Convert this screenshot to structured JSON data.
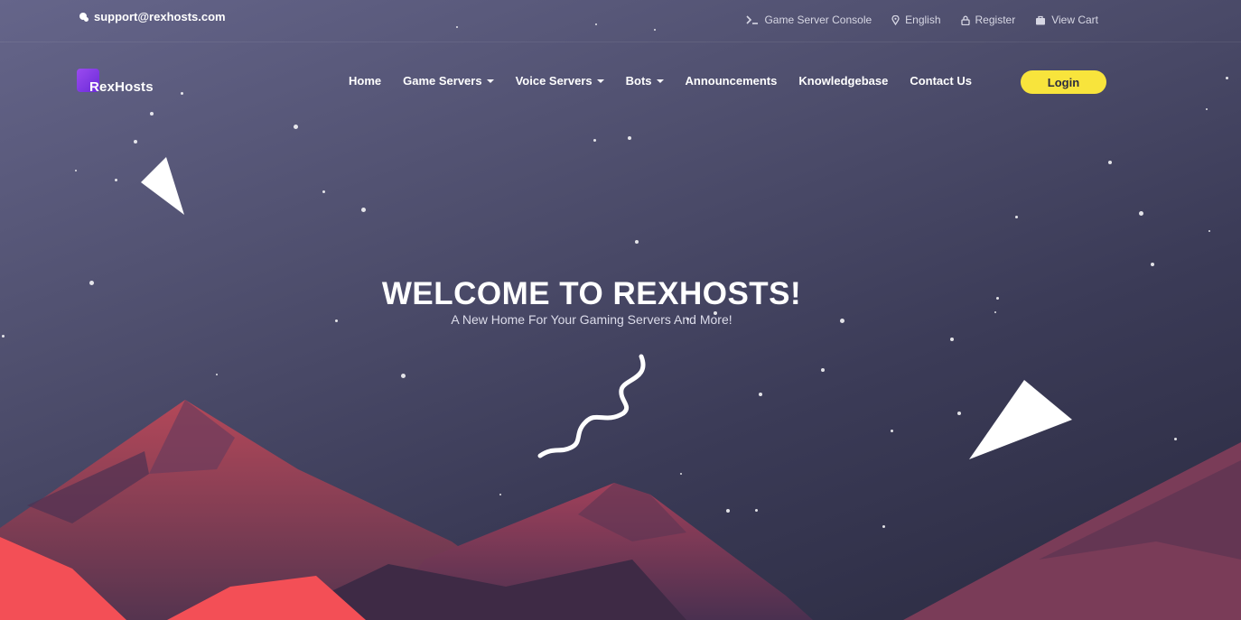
{
  "topbar": {
    "support_email": "support@rexhosts.com",
    "links": [
      {
        "label": "Game Server Console",
        "icon": "terminal-icon"
      },
      {
        "label": "English",
        "icon": "location-pin-icon"
      },
      {
        "label": "Register",
        "icon": "lock-icon"
      },
      {
        "label": "View Cart",
        "icon": "cart-icon"
      }
    ]
  },
  "brand": {
    "name": "RexHosts"
  },
  "nav": {
    "items": [
      {
        "label": "Home"
      },
      {
        "label": "Game Servers"
      },
      {
        "label": "Voice Servers"
      },
      {
        "label": "Bots"
      },
      {
        "label": "Announcements"
      },
      {
        "label": "Knowledgebase"
      },
      {
        "label": "Contact Us"
      }
    ],
    "login_label": "Login"
  },
  "hero": {
    "title": "WELCOME TO REXHOSTS!",
    "subtitle": "A New Home For Your Gaming Servers And More!"
  },
  "colors": {
    "login_button": "#f8e43c",
    "mountain_red": "#f34f56",
    "mountain_dark": "#5a3a57"
  }
}
